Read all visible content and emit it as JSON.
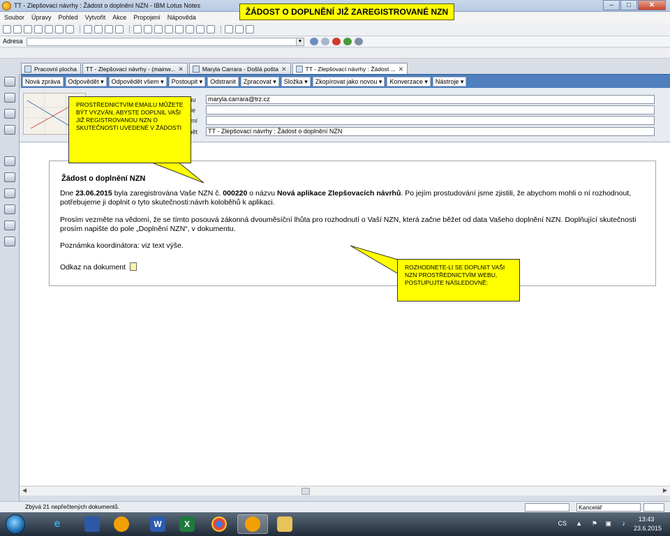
{
  "window": {
    "title": "TT - Zlepšovací návrhy : Žádost o doplnění NZN - IBM Lotus Notes",
    "minimize": "–",
    "maximize": "□",
    "close": "✕"
  },
  "banner": "ŽÁDOST O DOPLNĚNÍ JIŽ ZAREGISTROVANÉ NZN",
  "menu": [
    "Soubor",
    "Úpravy",
    "Pohled",
    "Vytvořit",
    "Akce",
    "Propojení",
    "Nápověda"
  ],
  "address": {
    "label": "Adresa",
    "value": ""
  },
  "tabs": [
    {
      "label": "Pracovní plocha",
      "closable": false
    },
    {
      "label": "TT - Zlepšovací návrhy - (mainw...",
      "closable": true
    },
    {
      "label": "Maryla Carrara - Došlá pošta",
      "closable": true
    },
    {
      "label": "TT - Zlepšovací návrhy : Žádost ...",
      "closable": true
    }
  ],
  "actions": [
    "Nová zpráva",
    "Odpovědět ▾",
    "Odpovědět všem ▾",
    "Postoupit ▾",
    "Odstranit",
    "Zpracovat ▾",
    "Složka ▾",
    "Zkopírovat jako novou ▾",
    "Konverzace ▾",
    "Nástroje ▾"
  ],
  "header": {
    "to_label": "mu",
    "to_value": "maryla.carrara@trz.cz",
    "cc_label": "pie",
    "cc_value": "",
    "bcc_label": "omí",
    "bcc_value": "",
    "subject_label": "mět",
    "subject_value": "TT - Zlepšovací návrhy : Žádost o doplnění NZN"
  },
  "memo": {
    "title": "Žádost o doplnění NZN",
    "p1_pre": "Dne ",
    "p1_date": "23.06.2015",
    "p1_mid": " byla zaregistrována Vaše NZN č. ",
    "p1_num": "000220",
    "p1_mid2": " o názvu ",
    "p1_name": "Nová aplikace Zlepšovacích návrhů",
    "p1_post": ". Po jejím prostudování jsme zjistili, že abychom mohli o ní rozhodnout, potřebujeme ji doplnit o tyto skutečnosti:návrh koloběhů k aplikaci.",
    "p2": "Prosím vezměte na vědomí, že se tímto posouvá zákonná dvouměsíční lhůta pro rozhodnutí o Vaší NZN, která začne běžet od data Vašeho doplnění NZN. Doplňující skutečnosti prosím napište do pole „Doplnění NZN“, v dokumentu.",
    "p3": "Poznámka koordinátora: viz text výše.",
    "p4": "Odkaz na dokument"
  },
  "callouts": {
    "left": "PROSTŘEDNICTVÍM EMAILU MŮŽETE BÝT VYZVÁN, ABYSTE DOPLNIL VAŠI JIŽ REGISTROVANOU NZN O SKUTEČNOSTI UVEDENÉ V ŽÁDOSTI",
    "right": "ROZHODNETE-LI SE DOPLNIT VAŠI NZN PROSTŘEDNICTVÍM WEBU, POSTUPUJTE NÁSLEDOVNĚ:"
  },
  "status": {
    "text": "Zbývá 21 nepřečtených dokumentů.",
    "location": "Kancelář"
  },
  "tray": {
    "lang": "CS",
    "time": "13:43",
    "date": "23.6.2015"
  },
  "colors": {
    "callout": "#ffff00",
    "actionbar": "#4f7fbe",
    "header_strip": "#e7ebf2"
  }
}
